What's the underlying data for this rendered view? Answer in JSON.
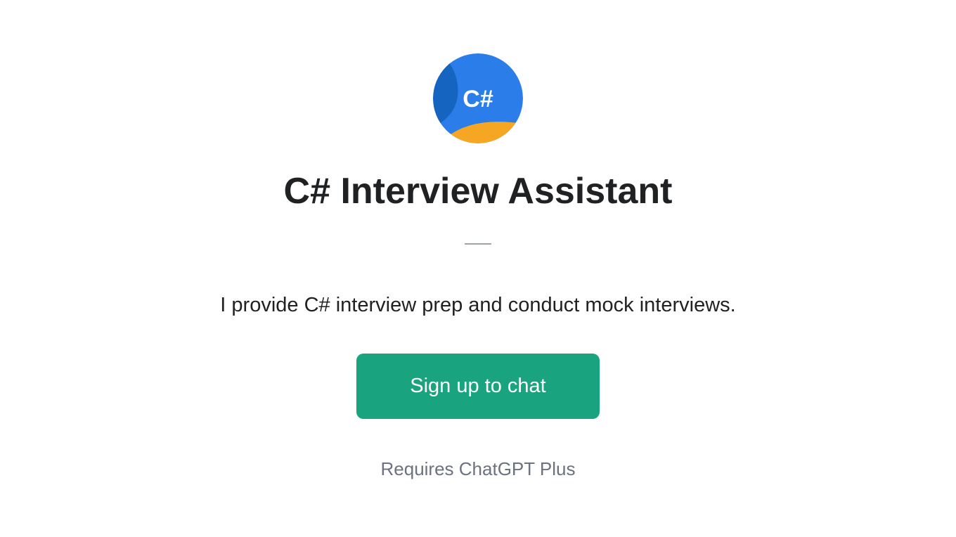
{
  "logo": {
    "text": "C#",
    "colors": {
      "blue_light": "#4a90e2",
      "blue_dark": "#1565c0",
      "yellow": "#f5a623"
    }
  },
  "title": "C# Interview Assistant",
  "description": "I provide C# interview prep and conduct mock interviews.",
  "button": {
    "signup_label": "Sign up to chat"
  },
  "requirement": "Requires ChatGPT Plus"
}
